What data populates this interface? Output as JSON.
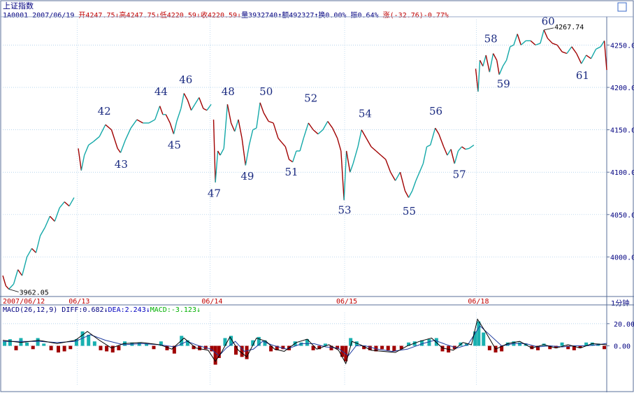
{
  "header": {
    "index_name": "上证指数",
    "info_line": [
      {
        "text": "1A0001 2007/06/19 ",
        "color": "#000080"
      },
      {
        "text": "开4247.75↓",
        "color": "#c00000"
      },
      {
        "text": "高4247.75↓",
        "color": "#c00000"
      },
      {
        "text": "低4220.59↓",
        "color": "#c00000"
      },
      {
        "text": "收4220.59↓",
        "color": "#c00000"
      },
      {
        "text": "量3932740↑",
        "color": "#000080"
      },
      {
        "text": "额492327↑",
        "color": "#000080"
      },
      {
        "text": "换0.00% ",
        "color": "#000080"
      },
      {
        "text": "振0.64% ",
        "color": "#000080"
      },
      {
        "text": "涨(-32.76)-0.77%",
        "color": "#c00000"
      }
    ]
  },
  "macd_header": [
    {
      "text": "MACD(26,12,9) ",
      "color": "#000080"
    },
    {
      "text": "DIFF:0.682↓",
      "color": "#000080"
    },
    {
      "text": "DEA:2.243↓",
      "color": "#0000c0"
    },
    {
      "text": "MACD:-3.123↓",
      "color": "#00b000"
    }
  ],
  "period_label": "1分钟",
  "chart_data": {
    "type": "line",
    "price_axis": {
      "ticks": [
        "4250.0",
        "4200.0",
        "4150.0",
        "4100.0",
        "4050.0",
        "4000.0"
      ],
      "values": [
        4250,
        4200,
        4150,
        4100,
        4050,
        4000
      ],
      "ylim": [
        3955,
        4280
      ]
    },
    "macd_axis": {
      "ticks": [
        "20.00",
        "0.00"
      ],
      "values": [
        20,
        0
      ],
      "ylim": [
        -35,
        30
      ]
    },
    "date_labels": [
      "2007/06/12",
      "06/13",
      "06/14",
      "06/15",
      "06/18"
    ],
    "price_series": [
      [
        0.0,
        3978
      ],
      [
        0.005,
        3966
      ],
      [
        0.01,
        3962.05
      ],
      [
        0.018,
        3968
      ],
      [
        0.025,
        3985
      ],
      [
        0.032,
        3978
      ],
      [
        0.04,
        4000
      ],
      [
        0.048,
        4010
      ],
      [
        0.055,
        4005
      ],
      [
        0.062,
        4025
      ],
      [
        0.07,
        4035
      ],
      [
        0.078,
        4048
      ],
      [
        0.086,
        4042
      ],
      [
        0.094,
        4058
      ],
      [
        0.102,
        4065
      ],
      [
        0.11,
        4060
      ],
      [
        0.118,
        4070
      ],
      null,
      [
        0.125,
        4128
      ],
      [
        0.13,
        4102
      ],
      [
        0.135,
        4120
      ],
      [
        0.142,
        4132
      ],
      [
        0.15,
        4136
      ],
      [
        0.16,
        4142
      ],
      [
        0.17,
        4156
      ],
      [
        0.18,
        4150
      ],
      [
        0.19,
        4128
      ],
      [
        0.195,
        4123
      ],
      [
        0.203,
        4138
      ],
      [
        0.212,
        4152
      ],
      [
        0.222,
        4162
      ],
      [
        0.232,
        4158
      ],
      [
        0.242,
        4158
      ],
      [
        0.252,
        4162
      ],
      [
        0.26,
        4178
      ],
      [
        0.265,
        4168
      ],
      [
        0.27,
        4168
      ],
      [
        0.277,
        4158
      ],
      [
        0.283,
        4145
      ],
      [
        0.288,
        4160
      ],
      [
        0.295,
        4175
      ],
      [
        0.3,
        4193
      ],
      [
        0.306,
        4185
      ],
      [
        0.312,
        4173
      ],
      [
        0.318,
        4180
      ],
      [
        0.325,
        4188
      ],
      [
        0.332,
        4175
      ],
      [
        0.338,
        4173
      ],
      [
        0.345,
        4180
      ],
      null,
      [
        0.349,
        4162
      ],
      [
        0.352,
        4088
      ],
      [
        0.356,
        4125
      ],
      [
        0.36,
        4120
      ],
      [
        0.366,
        4128
      ],
      [
        0.372,
        4180
      ],
      [
        0.378,
        4158
      ],
      [
        0.384,
        4148
      ],
      [
        0.39,
        4162
      ],
      [
        0.396,
        4140
      ],
      [
        0.402,
        4108
      ],
      [
        0.408,
        4132
      ],
      [
        0.414,
        4150
      ],
      [
        0.42,
        4152
      ],
      [
        0.426,
        4182
      ],
      [
        0.432,
        4170
      ],
      [
        0.44,
        4160
      ],
      [
        0.448,
        4158
      ],
      [
        0.456,
        4140
      ],
      [
        0.462,
        4135
      ],
      [
        0.468,
        4130
      ],
      [
        0.474,
        4115
      ],
      [
        0.48,
        4112
      ],
      [
        0.486,
        4125
      ],
      [
        0.492,
        4125
      ],
      [
        0.498,
        4140
      ],
      [
        0.506,
        4158
      ],
      [
        0.514,
        4150
      ],
      [
        0.522,
        4145
      ],
      [
        0.53,
        4150
      ],
      [
        0.538,
        4160
      ],
      [
        0.546,
        4152
      ],
      [
        0.554,
        4140
      ],
      [
        0.56,
        4125
      ],
      [
        0.565,
        4067
      ],
      [
        0.569,
        4125
      ],
      [
        0.575,
        4100
      ],
      [
        0.58,
        4110
      ],
      [
        0.588,
        4130
      ],
      [
        0.594,
        4150
      ],
      [
        0.602,
        4140
      ],
      [
        0.61,
        4130
      ],
      [
        0.618,
        4125
      ],
      [
        0.626,
        4120
      ],
      [
        0.634,
        4115
      ],
      [
        0.642,
        4100
      ],
      [
        0.65,
        4090
      ],
      [
        0.658,
        4100
      ],
      [
        0.666,
        4078
      ],
      [
        0.672,
        4070
      ],
      [
        0.678,
        4078
      ],
      [
        0.684,
        4090
      ],
      [
        0.69,
        4100
      ],
      [
        0.696,
        4110
      ],
      [
        0.702,
        4130
      ],
      [
        0.708,
        4132
      ],
      [
        0.716,
        4152
      ],
      [
        0.722,
        4145
      ],
      [
        0.73,
        4130
      ],
      [
        0.736,
        4120
      ],
      [
        0.742,
        4127
      ],
      [
        0.748,
        4110
      ],
      [
        0.754,
        4125
      ],
      [
        0.76,
        4130
      ],
      [
        0.766,
        4127
      ],
      [
        0.772,
        4128
      ],
      [
        0.78,
        4132
      ],
      null,
      [
        0.783,
        4222
      ],
      [
        0.787,
        4195
      ],
      [
        0.79,
        4232
      ],
      [
        0.795,
        4225
      ],
      [
        0.8,
        4238
      ],
      [
        0.806,
        4218
      ],
      [
        0.812,
        4240
      ],
      [
        0.818,
        4232
      ],
      [
        0.822,
        4215
      ],
      [
        0.828,
        4225
      ],
      [
        0.834,
        4232
      ],
      [
        0.84,
        4248
      ],
      [
        0.846,
        4250
      ],
      [
        0.852,
        4263
      ],
      [
        0.858,
        4250
      ],
      [
        0.866,
        4255
      ],
      [
        0.874,
        4255
      ],
      [
        0.882,
        4250
      ],
      [
        0.89,
        4252
      ],
      [
        0.896,
        4267.74
      ],
      [
        0.902,
        4258
      ],
      [
        0.91,
        4252
      ],
      [
        0.918,
        4250
      ],
      [
        0.926,
        4242
      ],
      [
        0.934,
        4240
      ],
      [
        0.942,
        4248
      ],
      [
        0.95,
        4240
      ],
      [
        0.958,
        4228
      ],
      [
        0.966,
        4238
      ],
      [
        0.974,
        4234
      ],
      [
        0.982,
        4245
      ],
      [
        0.99,
        4248
      ],
      [
        0.996,
        4255
      ],
      [
        1.0,
        4220.59
      ]
    ],
    "annotations": [
      {
        "label": "42",
        "x": 0.168,
        "y": 4168
      },
      {
        "label": "43",
        "x": 0.196,
        "y": 4105
      },
      {
        "label": "44",
        "x": 0.262,
        "y": 4191
      },
      {
        "label": "45",
        "x": 0.284,
        "y": 4128
      },
      {
        "label": "46",
        "x": 0.303,
        "y": 4205
      },
      {
        "label": "47",
        "x": 0.35,
        "y": 4071
      },
      {
        "label": "48",
        "x": 0.373,
        "y": 4191
      },
      {
        "label": "49",
        "x": 0.405,
        "y": 4091
      },
      {
        "label": "50",
        "x": 0.436,
        "y": 4191
      },
      {
        "label": "51",
        "x": 0.478,
        "y": 4096
      },
      {
        "label": "52",
        "x": 0.51,
        "y": 4183
      },
      {
        "label": "53",
        "x": 0.566,
        "y": 4051
      },
      {
        "label": "54",
        "x": 0.6,
        "y": 4165
      },
      {
        "label": "55",
        "x": 0.673,
        "y": 4050
      },
      {
        "label": "56",
        "x": 0.717,
        "y": 4168
      },
      {
        "label": "57",
        "x": 0.756,
        "y": 4093
      },
      {
        "label": "58",
        "x": 0.808,
        "y": 4253
      },
      {
        "label": "59",
        "x": 0.829,
        "y": 4200
      },
      {
        "label": "60",
        "x": 0.903,
        "y": 4274
      },
      {
        "label": "61",
        "x": 0.96,
        "y": 4210
      }
    ],
    "price_markers": [
      {
        "label": "3962.05",
        "x": 0.01,
        "y": 3962.05
      },
      {
        "label": "4267.74",
        "x": 0.896,
        "y": 4267.74
      }
    ],
    "macd_bars": [
      [
        0.003,
        4
      ],
      [
        0.012,
        6
      ],
      [
        0.022,
        -4
      ],
      [
        0.03,
        7
      ],
      [
        0.04,
        3
      ],
      [
        0.05,
        -3
      ],
      [
        0.058,
        7
      ],
      [
        0.068,
        2
      ],
      [
        0.08,
        -4
      ],
      [
        0.092,
        -6
      ],
      [
        0.102,
        -5
      ],
      [
        0.112,
        -3
      ],
      [
        0.122,
        6
      ],
      [
        0.132,
        13
      ],
      [
        0.142,
        10
      ],
      [
        0.152,
        4
      ],
      [
        0.162,
        -4
      ],
      [
        0.172,
        -5
      ],
      [
        0.182,
        -6
      ],
      [
        0.192,
        -4
      ],
      [
        0.202,
        4
      ],
      [
        0.214,
        3
      ],
      [
        0.226,
        3
      ],
      [
        0.238,
        2
      ],
      [
        0.25,
        -3
      ],
      [
        0.262,
        4
      ],
      [
        0.272,
        -4
      ],
      [
        0.284,
        -7
      ],
      [
        0.296,
        9
      ],
      [
        0.306,
        5
      ],
      [
        0.316,
        -3
      ],
      [
        0.326,
        -4
      ],
      [
        0.336,
        -3
      ],
      [
        0.346,
        -5
      ],
      [
        0.352,
        -17
      ],
      [
        0.358,
        -11
      ],
      [
        0.368,
        7
      ],
      [
        0.378,
        9
      ],
      [
        0.386,
        -8
      ],
      [
        0.396,
        -10
      ],
      [
        0.404,
        -12
      ],
      [
        0.414,
        5
      ],
      [
        0.424,
        8
      ],
      [
        0.434,
        5
      ],
      [
        0.444,
        -5
      ],
      [
        0.454,
        -4
      ],
      [
        0.464,
        -3
      ],
      [
        0.474,
        -4
      ],
      [
        0.484,
        4
      ],
      [
        0.494,
        3
      ],
      [
        0.504,
        6
      ],
      [
        0.514,
        -4
      ],
      [
        0.524,
        -3
      ],
      [
        0.534,
        2
      ],
      [
        0.544,
        -4
      ],
      [
        0.554,
        -3
      ],
      [
        0.562,
        -10
      ],
      [
        0.568,
        -14
      ],
      [
        0.576,
        7
      ],
      [
        0.586,
        4
      ],
      [
        0.598,
        -3
      ],
      [
        0.608,
        -4
      ],
      [
        0.618,
        -5
      ],
      [
        0.628,
        -3
      ],
      [
        0.638,
        -4
      ],
      [
        0.648,
        -5
      ],
      [
        0.66,
        -3
      ],
      [
        0.672,
        3
      ],
      [
        0.682,
        4
      ],
      [
        0.694,
        5
      ],
      [
        0.706,
        6
      ],
      [
        0.718,
        7
      ],
      [
        0.728,
        -5
      ],
      [
        0.738,
        -6
      ],
      [
        0.748,
        -3
      ],
      [
        0.758,
        3
      ],
      [
        0.768,
        2
      ],
      [
        0.782,
        13
      ],
      [
        0.788,
        22
      ],
      [
        0.796,
        12
      ],
      [
        0.806,
        -4
      ],
      [
        0.816,
        -6
      ],
      [
        0.826,
        -5
      ],
      [
        0.836,
        3
      ],
      [
        0.846,
        4
      ],
      [
        0.856,
        3
      ],
      [
        0.866,
        2
      ],
      [
        0.876,
        -3
      ],
      [
        0.886,
        -4
      ],
      [
        0.896,
        2
      ],
      [
        0.906,
        -3
      ],
      [
        0.916,
        -2
      ],
      [
        0.926,
        3
      ],
      [
        0.936,
        -3
      ],
      [
        0.946,
        -4
      ],
      [
        0.956,
        -2
      ],
      [
        0.966,
        3
      ],
      [
        0.976,
        3
      ],
      [
        0.986,
        2
      ],
      [
        0.996,
        -3
      ]
    ],
    "diff_series": [
      [
        0.0,
        5
      ],
      [
        0.03,
        3
      ],
      [
        0.06,
        5
      ],
      [
        0.09,
        2
      ],
      [
        0.12,
        5
      ],
      [
        0.14,
        13
      ],
      [
        0.16,
        5
      ],
      [
        0.18,
        -2
      ],
      [
        0.2,
        2
      ],
      [
        0.23,
        3
      ],
      [
        0.26,
        1
      ],
      [
        0.28,
        -3
      ],
      [
        0.3,
        7
      ],
      [
        0.32,
        -2
      ],
      [
        0.34,
        -4
      ],
      [
        0.352,
        -14
      ],
      [
        0.362,
        -6
      ],
      [
        0.376,
        8
      ],
      [
        0.39,
        -4
      ],
      [
        0.404,
        -10
      ],
      [
        0.42,
        7
      ],
      [
        0.436,
        4
      ],
      [
        0.45,
        -3
      ],
      [
        0.466,
        -5
      ],
      [
        0.486,
        3
      ],
      [
        0.504,
        6
      ],
      [
        0.52,
        -3
      ],
      [
        0.54,
        1
      ],
      [
        0.556,
        -4
      ],
      [
        0.568,
        -16
      ],
      [
        0.578,
        4
      ],
      [
        0.592,
        1
      ],
      [
        0.61,
        -4
      ],
      [
        0.63,
        -5
      ],
      [
        0.65,
        -6
      ],
      [
        0.67,
        0
      ],
      [
        0.69,
        4
      ],
      [
        0.71,
        7
      ],
      [
        0.728,
        -2
      ],
      [
        0.746,
        -4
      ],
      [
        0.762,
        3
      ],
      [
        0.776,
        1
      ],
      [
        0.786,
        24
      ],
      [
        0.8,
        12
      ],
      [
        0.816,
        -3
      ],
      [
        0.836,
        2
      ],
      [
        0.856,
        4
      ],
      [
        0.876,
        -2
      ],
      [
        0.896,
        1
      ],
      [
        0.916,
        -2
      ],
      [
        0.936,
        1
      ],
      [
        0.956,
        -2
      ],
      [
        0.976,
        2
      ],
      [
        1.0,
        1
      ]
    ],
    "dea_series": [
      [
        0.0,
        4
      ],
      [
        0.03,
        4
      ],
      [
        0.06,
        4
      ],
      [
        0.09,
        3
      ],
      [
        0.12,
        4
      ],
      [
        0.145,
        10
      ],
      [
        0.17,
        5
      ],
      [
        0.2,
        1
      ],
      [
        0.23,
        2
      ],
      [
        0.26,
        1
      ],
      [
        0.285,
        -1
      ],
      [
        0.305,
        4
      ],
      [
        0.325,
        0
      ],
      [
        0.345,
        -3
      ],
      [
        0.358,
        -9
      ],
      [
        0.37,
        -2
      ],
      [
        0.385,
        4
      ],
      [
        0.4,
        -5
      ],
      [
        0.415,
        -3
      ],
      [
        0.43,
        4
      ],
      [
        0.45,
        0
      ],
      [
        0.47,
        -3
      ],
      [
        0.495,
        2
      ],
      [
        0.515,
        2
      ],
      [
        0.535,
        -1
      ],
      [
        0.555,
        -2
      ],
      [
        0.572,
        -9
      ],
      [
        0.585,
        0
      ],
      [
        0.6,
        0
      ],
      [
        0.62,
        -3
      ],
      [
        0.645,
        -5
      ],
      [
        0.67,
        -3
      ],
      [
        0.695,
        2
      ],
      [
        0.715,
        5
      ],
      [
        0.735,
        1
      ],
      [
        0.752,
        -2
      ],
      [
        0.77,
        1
      ],
      [
        0.79,
        18
      ],
      [
        0.806,
        10
      ],
      [
        0.826,
        0
      ],
      [
        0.846,
        2
      ],
      [
        0.866,
        2
      ],
      [
        0.886,
        -1
      ],
      [
        0.906,
        0
      ],
      [
        0.926,
        -1
      ],
      [
        0.946,
        0
      ],
      [
        0.966,
        0
      ],
      [
        0.986,
        1
      ],
      [
        1.0,
        2.2
      ]
    ]
  }
}
